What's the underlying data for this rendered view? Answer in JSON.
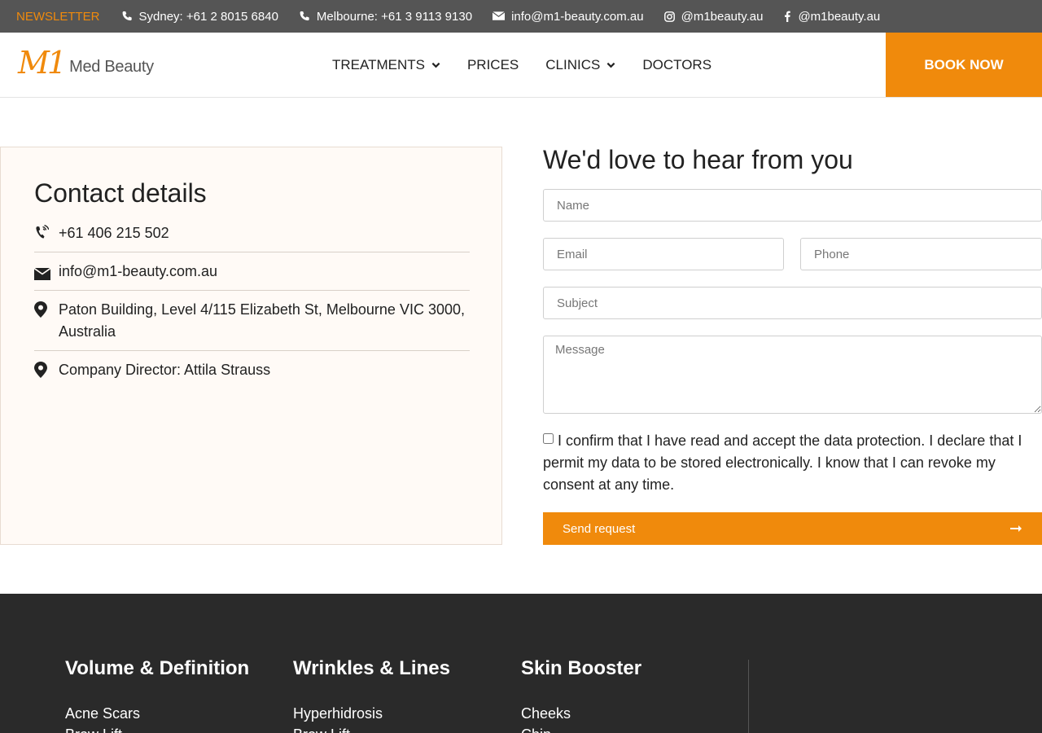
{
  "topbar": {
    "newsletter": "NEWSLETTER",
    "items": [
      {
        "icon": "phone-icon",
        "text": "Sydney: +61 2 8015 6840"
      },
      {
        "icon": "phone-icon",
        "text": "Melbourne: +61 3 9113 9130"
      },
      {
        "icon": "envelope-icon",
        "text": "info@m1-beauty.com.au"
      },
      {
        "icon": "instagram-icon",
        "text": "@m1beauty.au"
      },
      {
        "icon": "facebook-icon",
        "text": "@m1beauty.au"
      }
    ]
  },
  "header": {
    "logo_mark": "M1",
    "logo_text": "Med Beauty",
    "nav": [
      {
        "label": "TREATMENTS",
        "dropdown": true
      },
      {
        "label": "PRICES",
        "dropdown": false
      },
      {
        "label": "CLINICS",
        "dropdown": true
      },
      {
        "label": "DOCTORS",
        "dropdown": false
      }
    ],
    "book_now": "BOOK NOW"
  },
  "contact": {
    "title": "Contact details",
    "items": [
      {
        "icon": "phone-volume-icon",
        "text": "+61 406 215 502"
      },
      {
        "icon": "envelope-icon",
        "text": "info@m1-beauty.com.au"
      },
      {
        "icon": "map-marker-icon",
        "text": "Paton Building, Level 4/115 Elizabeth St, Melbourne VIC 3000, Australia"
      },
      {
        "icon": "map-marker-icon",
        "text": "Company Director: Attila Strauss"
      }
    ]
  },
  "form": {
    "title": "We'd love to hear from you",
    "name_placeholder": "Name",
    "email_placeholder": "Email",
    "phone_placeholder": "Phone",
    "subject_placeholder": "Subject",
    "message_placeholder": "Message",
    "consent_text": "I confirm that I have read and accept the data protection. I declare that I permit my data to be stored electronically. I know that I can revoke my consent at any time.",
    "consent_checked": false,
    "submit_label": "Send request"
  },
  "footer": {
    "columns": [
      {
        "title": "Volume & Definition",
        "links": [
          "Acne Scars",
          "Brow Lift"
        ]
      },
      {
        "title": "Wrinkles & Lines",
        "links": [
          "Hyperhidrosis",
          "Brow Lift"
        ]
      },
      {
        "title": "Skin Booster",
        "links": [
          "Cheeks",
          "Chin"
        ]
      }
    ]
  },
  "colors": {
    "accent": "#f08a0c",
    "topbar_bg": "#555555",
    "footer_bg": "#2a2a2a",
    "contact_bg": "#fffaf6"
  }
}
